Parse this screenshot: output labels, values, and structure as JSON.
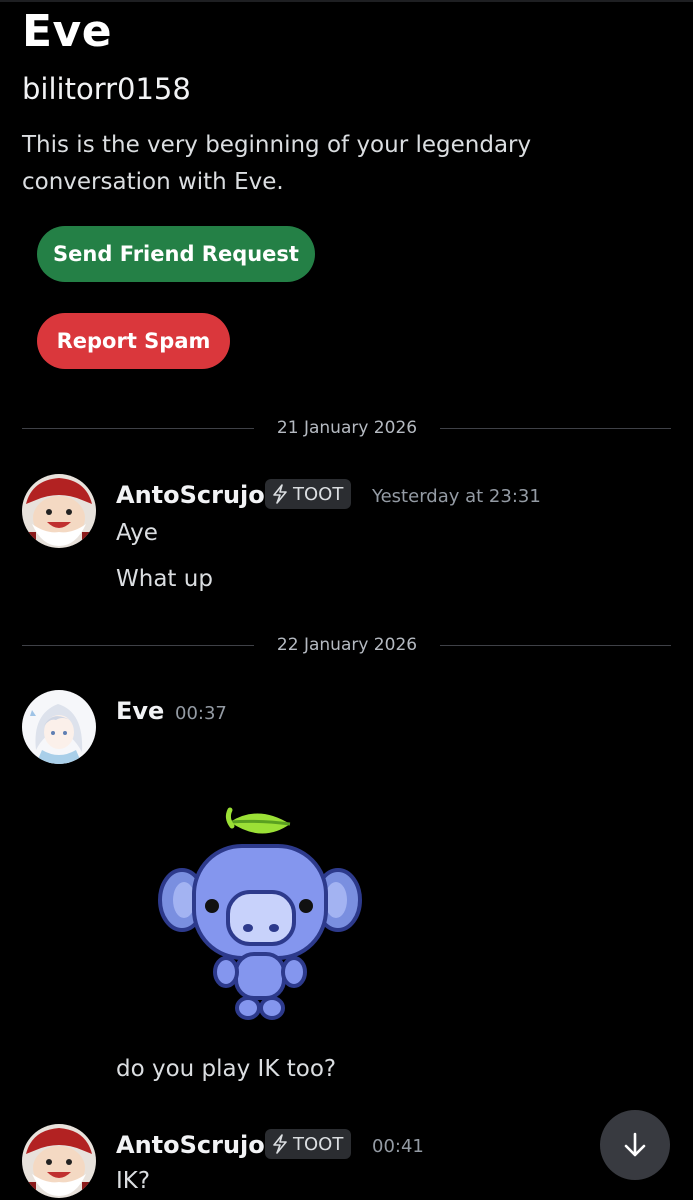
{
  "profile": {
    "display_name": "Eve",
    "username": "bilitorr0158",
    "intro": "This is the very beginning of your legendary conversation with Eve."
  },
  "actions": {
    "friend_request_label": "Send Friend Request",
    "report_spam_label": "Report Spam"
  },
  "colors": {
    "background": "#000000",
    "friend_button": "#248046",
    "spam_button": "#da373c",
    "muted_text": "#949ba4"
  },
  "dividers": [
    {
      "label": "21 January 2026"
    },
    {
      "label": "22 January 2026"
    }
  ],
  "messages": [
    {
      "author": "AntoScrujo",
      "tag_icon": "lightning-icon",
      "tag": "TOOT",
      "timestamp": "Yesterday at 23:31",
      "lines": [
        "Aye",
        "What up"
      ]
    },
    {
      "author": "Eve",
      "timestamp": "00:37",
      "sticker": "wumpus-sticker",
      "lines": [
        "do you play IK too?"
      ]
    },
    {
      "author": "AntoScrujo",
      "tag_icon": "lightning-icon",
      "tag": "TOOT",
      "timestamp": "00:41",
      "lines": [
        "IK?"
      ]
    }
  ],
  "scroll_button_icon": "arrow-down-icon"
}
